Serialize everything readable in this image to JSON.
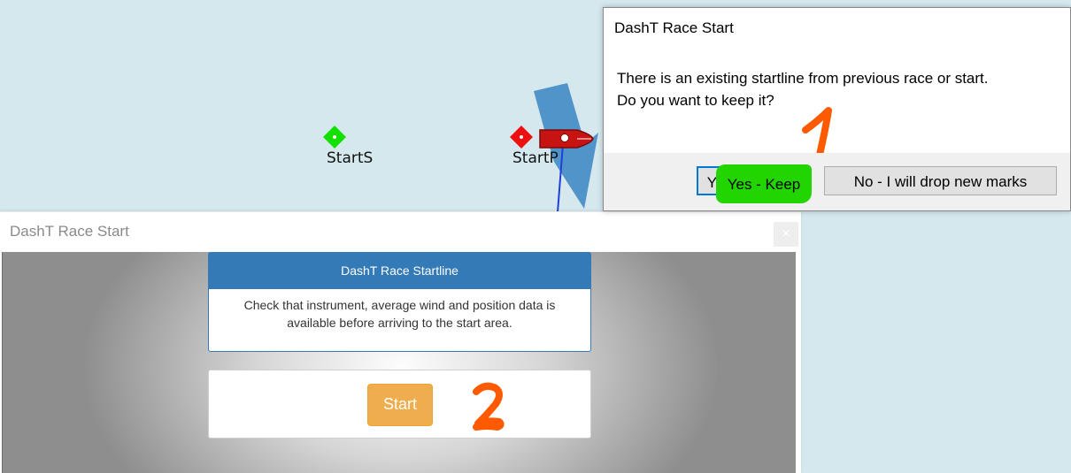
{
  "chart_map": {
    "marks": [
      {
        "name": "StartS",
        "color": "#12e000"
      },
      {
        "name": "StartP",
        "color": "#ee1010"
      }
    ],
    "water_color": "#d4e8ee",
    "boat_color": "#cc1111",
    "laylines_color": "#4a8fc6"
  },
  "race_dialog": {
    "title": "DashT Race Start",
    "close_label": "×",
    "info_panel": {
      "heading": "DashT Race Startline",
      "body_line1": "Check that instrument, average wind and position data is",
      "body_line2": "available before arriving to the start area."
    },
    "start_button": "Start",
    "annotation": "2"
  },
  "message_box": {
    "title": "DashT Race Start",
    "line1": "There is an existing startline from previous race or start.",
    "line2": "Do you want to keep it?",
    "yes_button": "Yes - Keep",
    "no_button": "No - I will drop new marks",
    "annotation": "1",
    "highlight_color": "#22d400",
    "annotation_color": "#ff5a00"
  }
}
